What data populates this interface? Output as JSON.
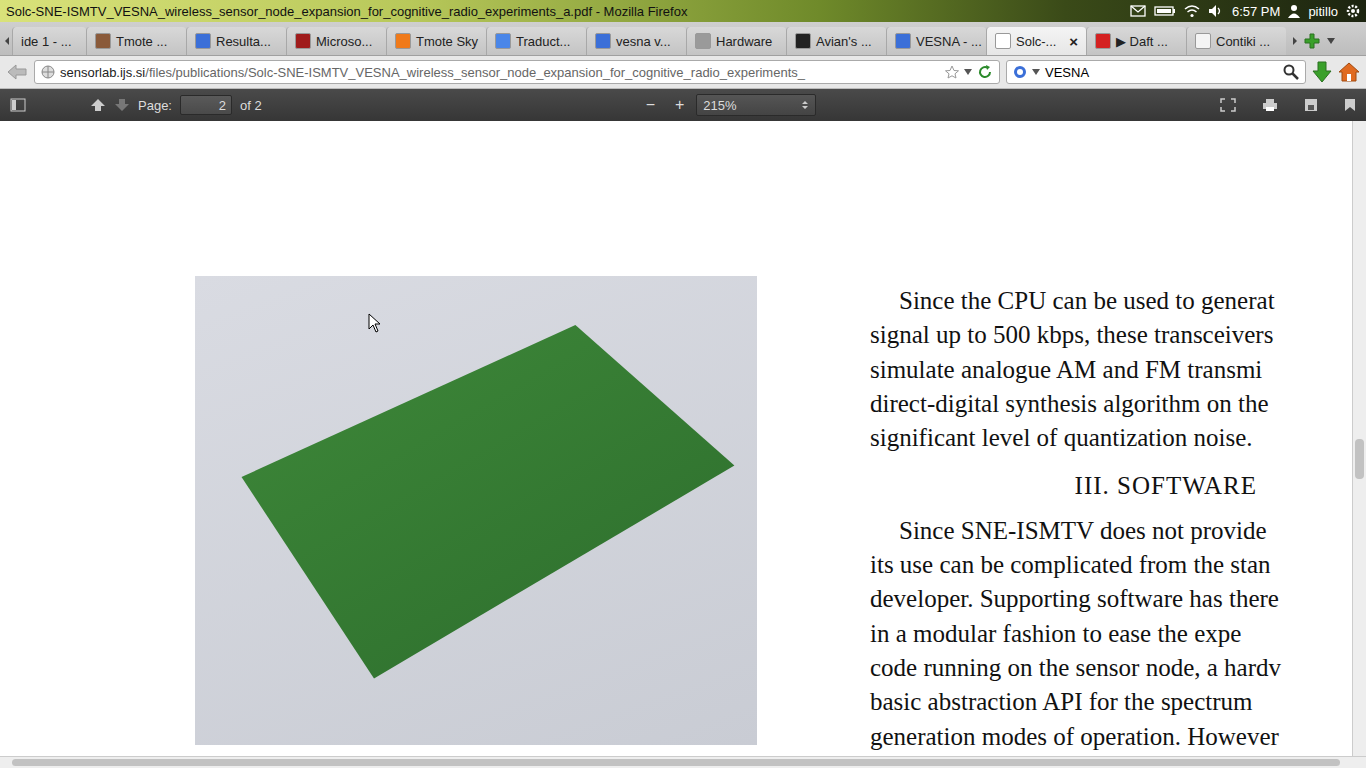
{
  "system_bar": {
    "title": "Solc-SNE-ISMTV_VESNA_wireless_sensor_node_expansion_for_cognitive_radio_experiments_a.pdf - Mozilla Firefox",
    "time": "6:57 PM",
    "user": "pitillo"
  },
  "tabs": [
    {
      "label": "ide 1 - ...",
      "selected": false,
      "color": ""
    },
    {
      "label": "Tmote ...",
      "selected": false,
      "color": "#8a5a3a"
    },
    {
      "label": "Resulta...",
      "selected": false,
      "color": "#3b6fd8"
    },
    {
      "label": "Microso...",
      "selected": false,
      "color": "#a01c1c"
    },
    {
      "label": "Tmote Sky",
      "selected": false,
      "color": "#f07a1a"
    },
    {
      "label": "Traduct...",
      "selected": false,
      "color": "#4a86e8"
    },
    {
      "label": "vesna v...",
      "selected": false,
      "color": "#3b6fd8"
    },
    {
      "label": "Hardware",
      "selected": false,
      "color": "#9a9a9a"
    },
    {
      "label": "Avian's ...",
      "selected": false,
      "color": "#222222"
    },
    {
      "label": "VESNA - ...",
      "selected": false,
      "color": "#3b6fd8"
    },
    {
      "label": "Solc-...",
      "selected": true,
      "color": "#ffffff"
    },
    {
      "label": "▶ Daft ...",
      "selected": false,
      "color": "#d42020"
    },
    {
      "label": "Contiki ...",
      "selected": false,
      "color": "#f4f4f4"
    }
  ],
  "tab_close": "×",
  "nav": {
    "url_host": "sensorlab.ijs.si",
    "url_path": "/files/publications/Solc-SNE-ISMTV_VESNA_wireless_sensor_node_expansion_for_cognitive_radio_experiments_",
    "search": "VESNA"
  },
  "pdf_toolbar": {
    "page_label": "Page:",
    "page": "2",
    "page_count": "of 2",
    "zoom_out": "−",
    "zoom_in": "+",
    "zoom": "215%"
  },
  "document": {
    "blocks": [
      {
        "kind": "text",
        "lines": [
          "Since the CPU can be used to generat",
          "signal up to 500 kbps, these transceivers",
          "simulate analogue AM and FM transmi",
          "direct-digital synthesis algorithm on the",
          "significant level of quantization noise."
        ]
      },
      {
        "kind": "heading",
        "lines": [
          "III. SOFTWARE"
        ]
      },
      {
        "kind": "text",
        "lines": [
          "Since SNE-ISMTV does not provide",
          "its use can be complicated from the stan",
          "developer. Supporting software has there",
          "in a modular fashion to ease the expe",
          "code running on the sensor node, a hardv",
          "basic abstraction API for the spectrum",
          "generation modes of operation. However"
        ]
      }
    ]
  }
}
